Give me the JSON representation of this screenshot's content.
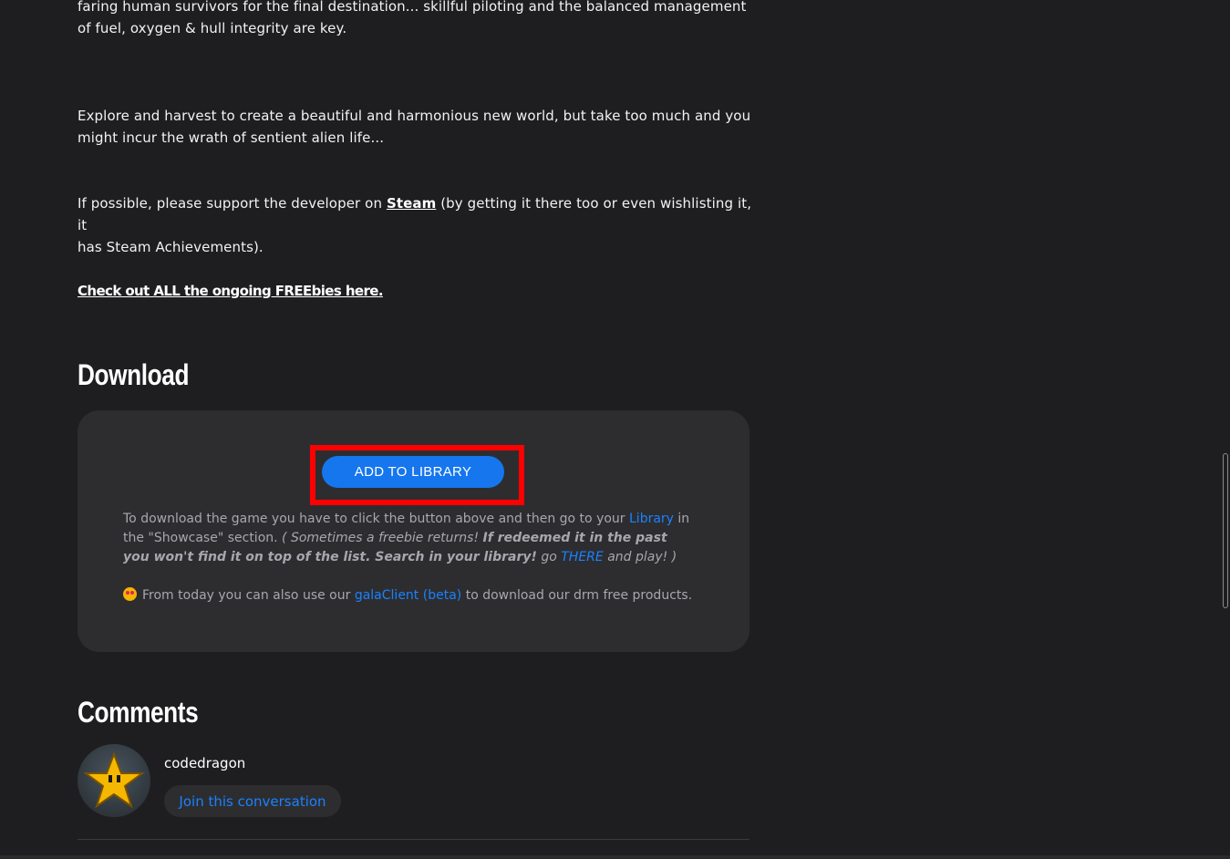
{
  "description": {
    "p1_line1": "faring human survivors for the final destination... skillful piloting and the balanced management",
    "p1_line2": "of fuel, oxygen & hull integrity are key.",
    "p2_line1": "Explore and harvest to create a beautiful and harmonious new world, but take too much and you",
    "p2_line2": "might incur the wrath of sentient alien life...",
    "p3_pre": "If possible, please support the developer on ",
    "p3_link": "Steam",
    "p3_post": " (by getting it there too or even wishlisting it, it",
    "p3_line2": "has Steam Achievements).",
    "freebies_link": "Check out ALL the ongoing FREEbies here."
  },
  "download": {
    "heading": "Download",
    "add_button": "ADD TO LIBRARY",
    "instr_1": "To download the game you have to click the button above and then go to your ",
    "instr_library": "Library",
    "instr_2": " in the \"Showcase\" section. ",
    "instr_italic_1": "( Sometimes a freebie returns! ",
    "instr_bold_italic": "If redeemed it in the past you won't find it on top of the list. Search in your library!",
    "instr_italic_2": " go ",
    "instr_there": "THERE",
    "instr_italic_3": " and play! )",
    "client_pre": "From today you can also use our ",
    "client_link": "galaClient (beta)",
    "client_post": " to download our drm free products."
  },
  "comments": {
    "heading": "Comments",
    "username": "codedragon",
    "join_button": "Join this conversation"
  },
  "colors": {
    "background": "#1e1e20",
    "card": "#2d2d30",
    "accent_blue": "#1576ee",
    "highlight_red": "#ff0000"
  },
  "icons": {
    "avatar": "star-avatar-icon",
    "emoji": "star-struck-emoji-icon"
  }
}
